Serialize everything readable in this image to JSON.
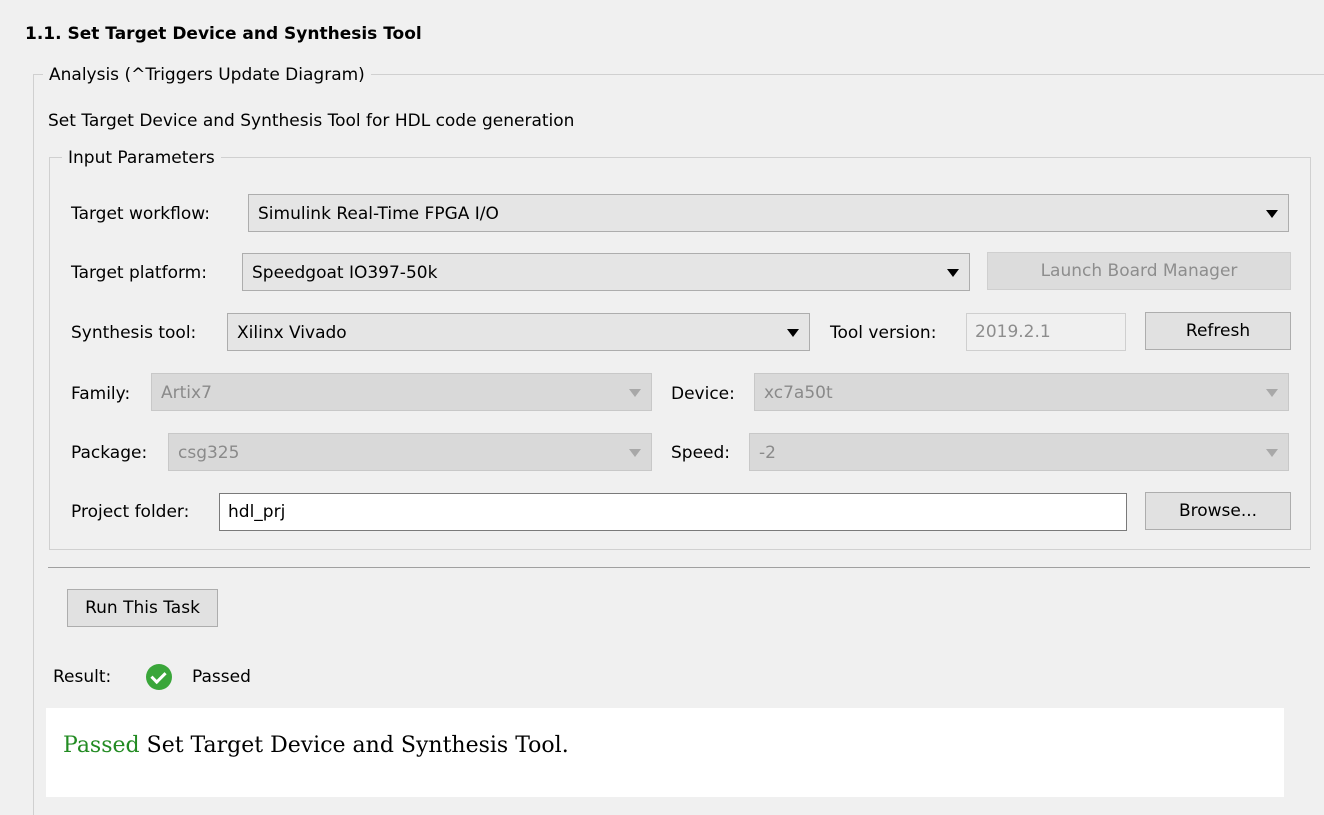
{
  "title": "1.1. Set Target Device and Synthesis Tool",
  "analysis": {
    "legend": "Analysis (^Triggers Update Diagram)",
    "description": "Set Target Device and Synthesis Tool for HDL code generation"
  },
  "input_params": {
    "legend": "Input Parameters",
    "target_workflow": {
      "label": "Target workflow:",
      "value": "Simulink Real-Time FPGA I/O"
    },
    "target_platform": {
      "label": "Target platform:",
      "value": "Speedgoat IO397-50k"
    },
    "launch_board_manager": "Launch Board Manager",
    "synthesis_tool": {
      "label": "Synthesis tool:",
      "value": "Xilinx Vivado"
    },
    "tool_version": {
      "label": "Tool version:",
      "value": "2019.2.1"
    },
    "refresh": "Refresh",
    "family": {
      "label": "Family:",
      "value": "Artix7"
    },
    "device": {
      "label": "Device:",
      "value": "xc7a50t"
    },
    "package": {
      "label": "Package:",
      "value": "csg325"
    },
    "speed": {
      "label": "Speed:",
      "value": "-2"
    },
    "project_folder": {
      "label": "Project folder:",
      "value": "hdl_prj"
    },
    "browse": "Browse..."
  },
  "run_task": "Run This Task",
  "result": {
    "label": "Result:",
    "status": "Passed",
    "message_status": "Passed",
    "message_text": "Set Target Device and Synthesis Tool."
  },
  "colors": {
    "passed_green": "#228b22",
    "icon_green": "#3aa63a"
  }
}
